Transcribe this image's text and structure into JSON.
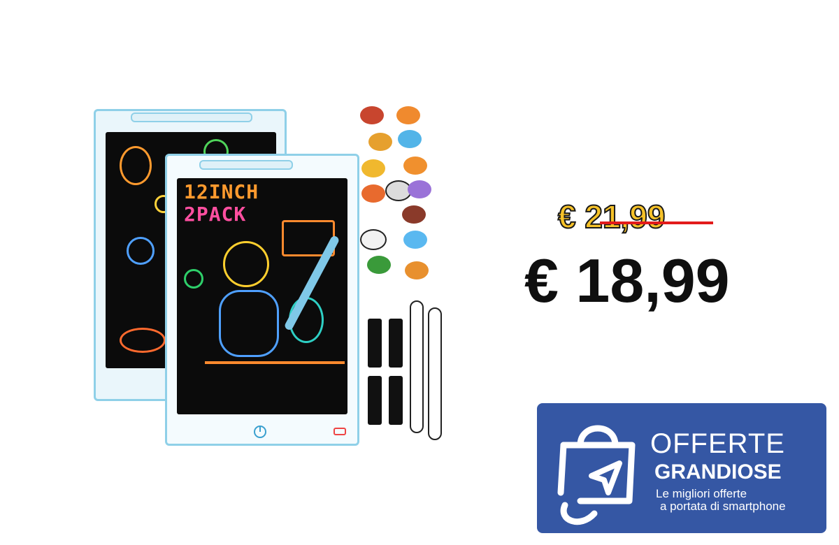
{
  "product": {
    "screen_text_line1": "12INCH",
    "screen_text_line2": "2PACK",
    "colors": {
      "tablet_frame": "#8fd0e8",
      "screen": "#0b0b0b",
      "stylus": "#7fc8e8"
    }
  },
  "pricing": {
    "old_price": "€ 21,99",
    "new_price": "€ 18,99",
    "colors": {
      "old_price": "#f6c229",
      "strike": "#e21b1b",
      "new_price": "#0f0f0f"
    }
  },
  "banner": {
    "title": "OFFERTE",
    "subtitle": "GRANDIOSE",
    "tagline_line1": "Le migliori offerte",
    "tagline_line2": "a portata di smartphone",
    "icon": "shopping-bag-cursor-icon",
    "colors": {
      "background": "#3557a4",
      "text": "#ffffff"
    }
  }
}
